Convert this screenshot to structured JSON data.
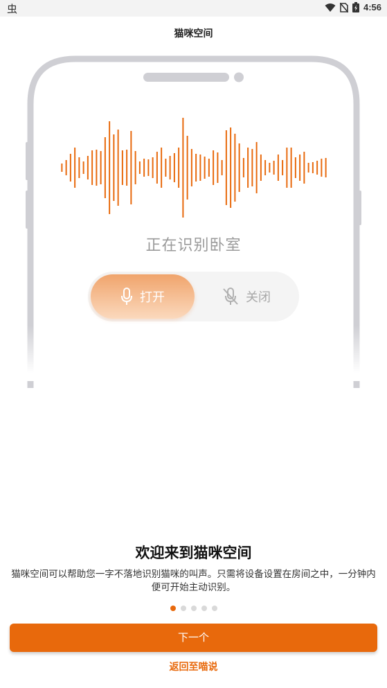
{
  "status_bar": {
    "left_glyph": "虫",
    "time": "4:56",
    "icons": [
      "wifi-icon",
      "no-sim-icon",
      "battery-icon"
    ]
  },
  "header": {
    "title": "猫咪空间"
  },
  "illustration": {
    "caption": "正在识别卧室",
    "wave_color": "#e8690c",
    "toggle": {
      "on_label": "打开",
      "off_label": "关闭",
      "selected": "on"
    }
  },
  "welcome": {
    "title": "欢迎来到猫咪空间",
    "description": "猫咪空间可以帮助您一字不落地识别猫咪的叫声。只需将设备设置在房间之中，一分钟内便可开始主动识别。"
  },
  "pager": {
    "total": 5,
    "current": 1
  },
  "actions": {
    "next_label": "下一个",
    "back_label": "返回至喵说"
  },
  "colors": {
    "accent": "#e8690c",
    "toggle_gradient_top": "#f0a46c",
    "toggle_gradient_bottom": "#fbd9bd"
  }
}
